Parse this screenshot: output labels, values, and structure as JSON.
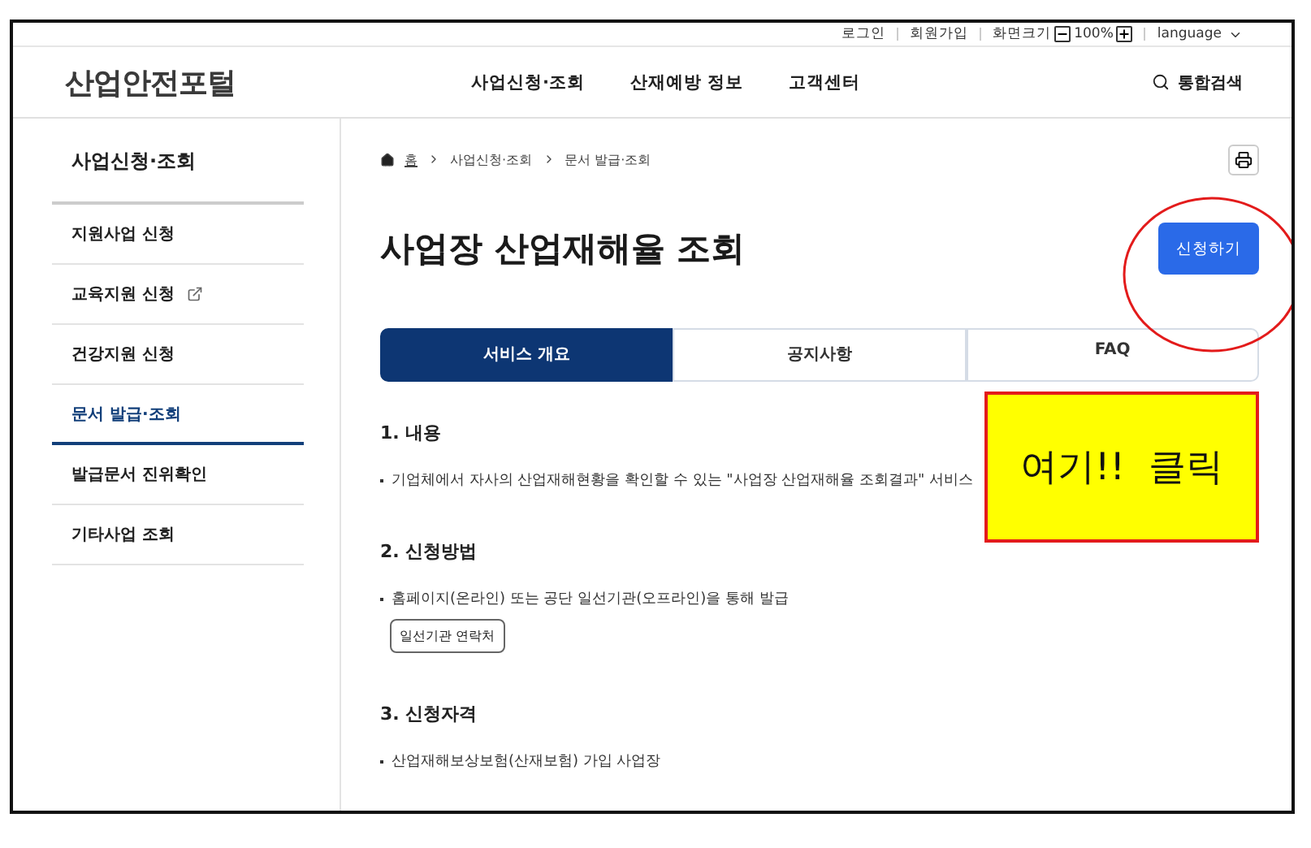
{
  "utility_bar": {
    "links": [
      "로그인",
      "회원가입"
    ],
    "zoom_label": "화면크기",
    "zoom_value": "100%",
    "language": "language"
  },
  "header": {
    "logo": "산업안전포털",
    "nav": [
      "사업신청·조회",
      "산재예방 정보",
      "고객센터"
    ],
    "search": "통합검색"
  },
  "sidebar": {
    "title": "사업신청·조회",
    "items": [
      {
        "label": "지원사업 신청",
        "external": false,
        "selected": false
      },
      {
        "label": "교육지원 신청",
        "external": true,
        "selected": false
      },
      {
        "label": "건강지원 신청",
        "external": false,
        "selected": false
      },
      {
        "label": "문서 발급·조회",
        "external": false,
        "selected": true
      },
      {
        "label": "발급문서 진위확인",
        "external": false,
        "selected": false
      },
      {
        "label": "기타사업 조회",
        "external": false,
        "selected": false
      }
    ]
  },
  "breadcrumb": [
    "홈",
    "사업신청·조회",
    "문서 발급·조회"
  ],
  "page_title": "사업장 산업재해율 조회",
  "apply_button": "신청하기",
  "tabs": [
    {
      "label": "서비스 개요",
      "selected": true
    },
    {
      "label": "공지사항",
      "selected": false
    },
    {
      "label": "FAQ",
      "selected": false
    }
  ],
  "sections": [
    {
      "heading": "1. 내용",
      "bullet": "기업체에서 자사의 산업재해현황을 확인할 수 있는 \"사업장 산업재해율 조회결과\" 서비스"
    },
    {
      "heading": "2. 신청방법",
      "bullet": "홈페이지(온라인) 또는 공단 일선기관(오프라인)을 통해 발급",
      "button": "일선기관 연락처"
    },
    {
      "heading": "3. 신청자격",
      "bullet": "산업재해보상보험(산재보험) 가입 사업장"
    }
  ],
  "annotation": {
    "callout": "여기!!  클릭"
  }
}
